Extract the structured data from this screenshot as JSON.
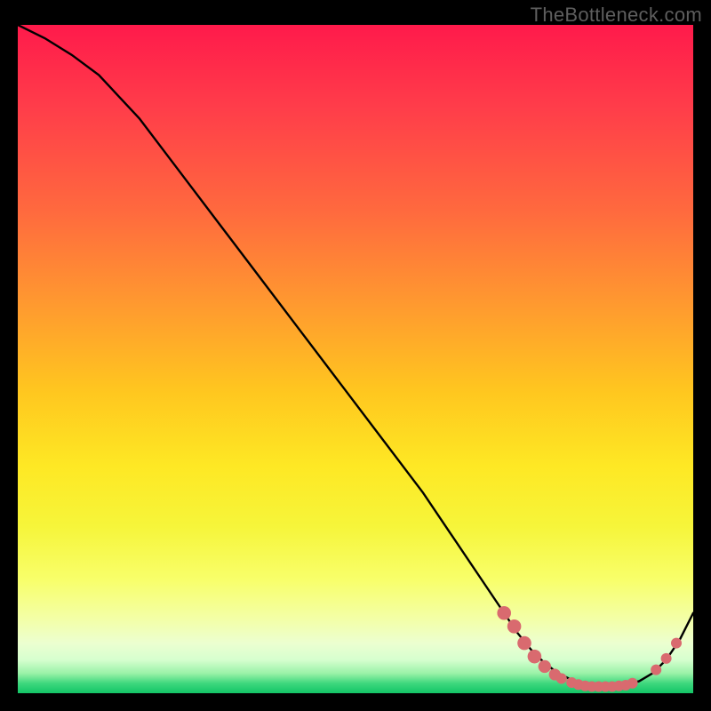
{
  "watermark": "TheBottleneck.com",
  "chart_data": {
    "type": "line",
    "title": "",
    "xlabel": "",
    "ylabel": "",
    "xlim": [
      0,
      100
    ],
    "ylim": [
      0,
      100
    ],
    "series": [
      {
        "name": "curve",
        "x": [
          0,
          4,
          8,
          12,
          18,
          24,
          30,
          36,
          42,
          48,
          54,
          60,
          64,
          68,
          72,
          74,
          76,
          78,
          80,
          82,
          84,
          86,
          88,
          90,
          92,
          94,
          96,
          98,
          100
        ],
        "y": [
          100,
          98,
          95.5,
          92.5,
          86,
          78,
          70,
          62,
          54,
          46,
          38,
          30,
          24,
          18,
          12,
          9,
          6.5,
          4.5,
          3,
          2,
          1.3,
          1,
          1,
          1.2,
          1.8,
          3,
          5,
          8,
          12
        ]
      }
    ],
    "markers": [
      {
        "x": 72,
        "y": 12,
        "r": 1.3
      },
      {
        "x": 73.5,
        "y": 10,
        "r": 1.3
      },
      {
        "x": 75,
        "y": 7.5,
        "r": 1.3
      },
      {
        "x": 76.5,
        "y": 5.5,
        "r": 1.3
      },
      {
        "x": 78,
        "y": 4,
        "r": 1.2
      },
      {
        "x": 79.5,
        "y": 2.8,
        "r": 1.1
      },
      {
        "x": 80.5,
        "y": 2.2,
        "r": 1.0
      },
      {
        "x": 82,
        "y": 1.6,
        "r": 1.0
      },
      {
        "x": 83,
        "y": 1.3,
        "r": 1.0
      },
      {
        "x": 84,
        "y": 1.1,
        "r": 1.0
      },
      {
        "x": 85,
        "y": 1.0,
        "r": 1.0
      },
      {
        "x": 86,
        "y": 1.0,
        "r": 1.0
      },
      {
        "x": 87,
        "y": 1.0,
        "r": 1.0
      },
      {
        "x": 88,
        "y": 1.0,
        "r": 1.0
      },
      {
        "x": 89,
        "y": 1.1,
        "r": 1.0
      },
      {
        "x": 90,
        "y": 1.2,
        "r": 1.0
      },
      {
        "x": 91,
        "y": 1.5,
        "r": 1.0
      },
      {
        "x": 94.5,
        "y": 3.5,
        "r": 1.0
      },
      {
        "x": 96,
        "y": 5.2,
        "r": 1.0
      },
      {
        "x": 97.5,
        "y": 7.5,
        "r": 1.0
      }
    ],
    "colors": {
      "curve": "#000000",
      "marker": "#d96a6f",
      "gradient_top": "#ff1a4b",
      "gradient_bottom": "#13c566",
      "background": "#000000"
    }
  }
}
